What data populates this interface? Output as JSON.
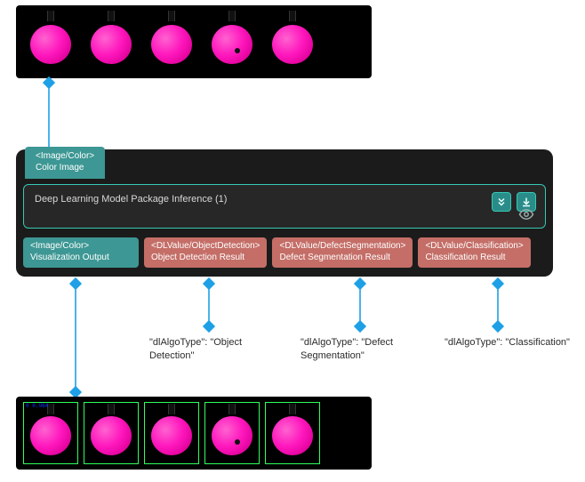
{
  "top_strip": {
    "alt": "Input color image with 5 pink bulbs",
    "defect_index": 3
  },
  "node": {
    "input_tab": {
      "type_line": "<Image/Color>",
      "label": "Color Image"
    },
    "title": "Deep Learning Model Package Inference (1)",
    "buttons": {
      "expand": "chevrons-down-icon",
      "run": "download-icon",
      "view": "eye-icon"
    },
    "outputs": [
      {
        "kind": "viz",
        "type_line": "<Image/Color>",
        "label": "Visualization Output"
      },
      {
        "kind": "red",
        "type_line": "<DLValue/ObjectDetection>",
        "label": "Object Detection Result"
      },
      {
        "kind": "red",
        "type_line": "<DLValue/DefectSegmentation>",
        "label": "Defect Segmentation Result"
      },
      {
        "kind": "red",
        "type_line": "<DLValue/Classification>",
        "label": "Classification Result"
      }
    ]
  },
  "captions": {
    "obj": "\"dlAlgoType\": \"Object Detection\"",
    "seg": "\"dlAlgoType\": \"Defect Segmentation\"",
    "cls": "\"dlAlgoType\": \"Classification\""
  },
  "bottom_strip": {
    "alt": "Visualization output with detection boxes",
    "box_label_example": "0  0.984"
  }
}
